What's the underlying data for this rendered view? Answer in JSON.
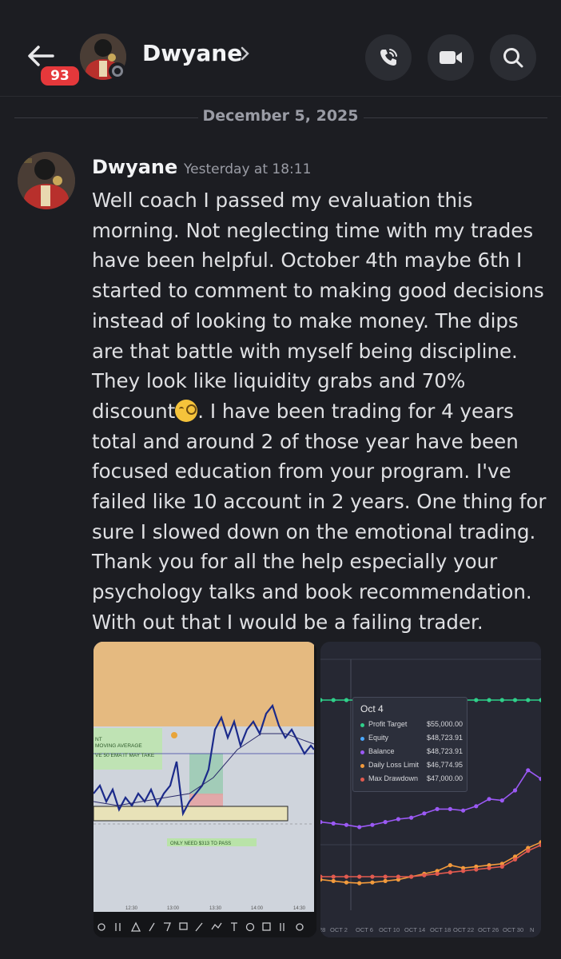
{
  "header": {
    "back_badge": "93",
    "contact_name": "Dwyane",
    "actions": [
      "phone-call-icon",
      "video-camera-icon",
      "search-icon"
    ]
  },
  "date_divider": "December 5, 2025",
  "message": {
    "author": "Dwyane",
    "timestamp": "Yesterday at 18:11",
    "text_before_emoji": "Well coach I passed my evaluation this morning. Not neglecting time with my trades have been helpful. October 4th maybe 6th I started to comment to making good decisions instead of looking to make money. The dips are that battle with myself being discipline. They look like liquidity grabs and 70% discount",
    "emoji": "face-with-monocle",
    "text_after_emoji": ". I have been trading for 4 years total and around 2 of those year have been focused education from your program. I've failed like 10 account in 2 years. One thing for sure I slowed down on the emotional trading. Thank you for all the help especially your psychology talks and book recommendation. With out that I would be a failing trader."
  },
  "attachment_left": {
    "notes": [
      "NT",
      "MOVING AVERAGE",
      "VE 50 EMA IT MAY TAKE",
      "ONLY NEED $313 TO PASS"
    ],
    "time_labels": [
      "12:30",
      "13:00",
      "13:30",
      "14:00",
      "14:30"
    ],
    "toolbar_icons": [
      "pin-icon",
      "bars-icon",
      "triangle-icon",
      "pencil-icon",
      "ruler-icon",
      "comment-icon",
      "brush-icon",
      "line-icon",
      "text-icon",
      "add-icon",
      "image-icon",
      "fork-icon",
      "eye-icon"
    ]
  },
  "attachment_right": {
    "tooltip": {
      "title": "Oct 4",
      "rows": [
        {
          "label": "Profit Target",
          "value": "$55,000.00",
          "color": "#2fd08a"
        },
        {
          "label": "Equity",
          "value": "$48,723.91",
          "color": "#4aa8ff"
        },
        {
          "label": "Balance",
          "value": "$48,723.91",
          "color": "#9b59f5"
        },
        {
          "label": "Daily Loss Limit",
          "value": "$46,774.95",
          "color": "#f29a3c"
        },
        {
          "label": "Max Drawdown",
          "value": "$47,000.00",
          "color": "#e25a4f"
        }
      ]
    },
    "x_labels": [
      "28",
      "OCT 2",
      "OCT 6",
      "OCT 10",
      "OCT 14",
      "OCT 18",
      "OCT 22",
      "OCT 26",
      "OCT 30",
      "N"
    ]
  },
  "chart_data": {
    "type": "line",
    "x": [
      "Sep 28",
      "Sep 30",
      "Oct 2",
      "Oct 4",
      "Oct 6",
      "Oct 8",
      "Oct 10",
      "Oct 12",
      "Oct 14",
      "Oct 16",
      "Oct 18",
      "Oct 20",
      "Oct 22",
      "Oct 24",
      "Oct 26",
      "Oct 28",
      "Oct 30",
      "Nov 1"
    ],
    "series": [
      {
        "name": "Profit Target",
        "values": [
          55000,
          55000,
          55000,
          55000,
          55000,
          55000,
          55000,
          55000,
          55000,
          55000,
          55000,
          55000,
          55000,
          55000,
          55000,
          55000,
          55000,
          55000
        ]
      },
      {
        "name": "Balance",
        "values": [
          48900,
          48850,
          48800,
          48724,
          48800,
          48900,
          49000,
          49050,
          49200,
          49350,
          49350,
          49300,
          49450,
          49700,
          49650,
          50000,
          50700,
          50400
        ]
      },
      {
        "name": "Daily Loss Limit",
        "values": [
          46900,
          46850,
          46800,
          46775,
          46800,
          46850,
          46900,
          47000,
          47100,
          47200,
          47400,
          47300,
          47350,
          47400,
          47450,
          47700,
          48000,
          48200
        ]
      },
      {
        "name": "Max Drawdown",
        "values": [
          47000,
          47000,
          47000,
          47000,
          47000,
          47000,
          47000,
          47000,
          47050,
          47100,
          47150,
          47200,
          47250,
          47300,
          47350,
          47600,
          47900,
          48100
        ]
      }
    ]
  }
}
